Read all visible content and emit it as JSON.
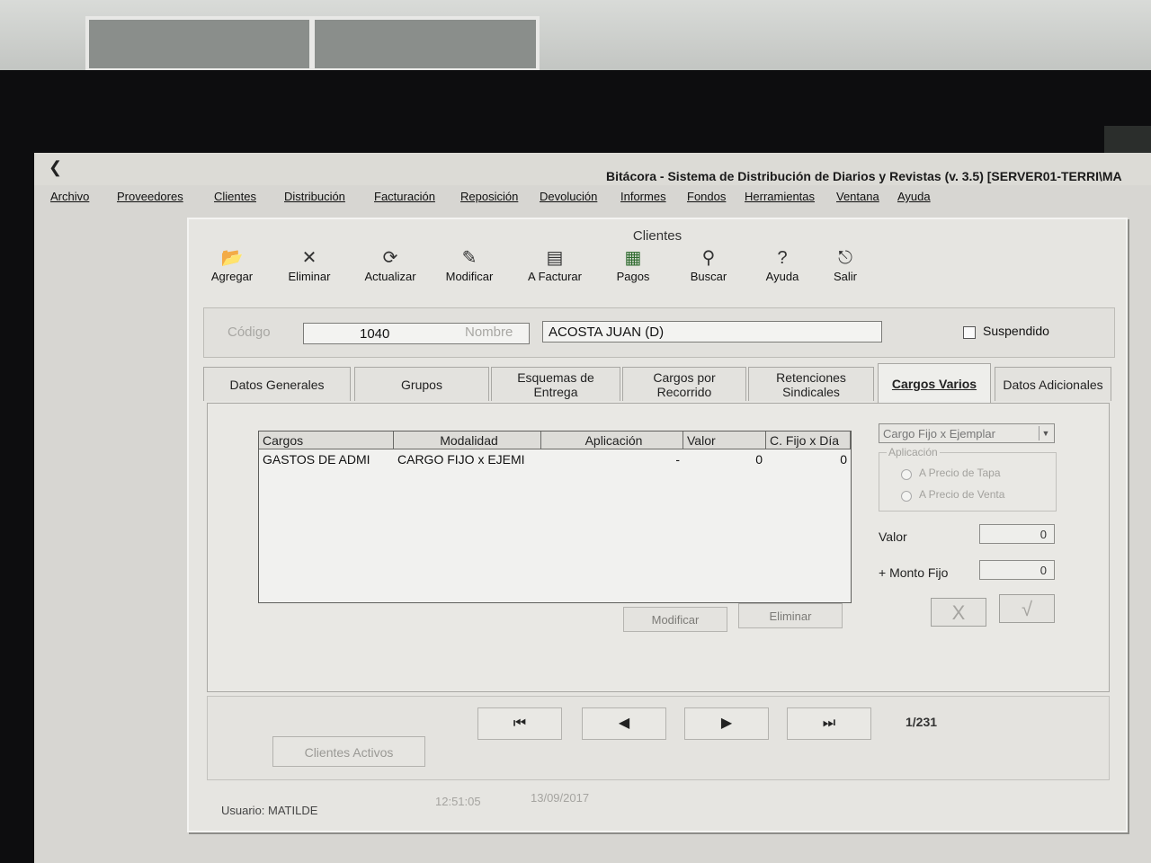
{
  "app": {
    "title": "Bitácora - Sistema de Distribución de Diarios y Revistas (v. 3.5) [SERVER01-TERRI\\MA",
    "menu": [
      "Archivo",
      "Proveedores",
      "Clientes",
      "Distribución",
      "Facturación",
      "Reposición",
      "Devolución",
      "Informes",
      "Fondos",
      "Herramientas",
      "Ventana",
      "Ayuda"
    ]
  },
  "dialog": {
    "title": "Clientes",
    "toolbar": [
      {
        "label": "Agregar",
        "icon": "folder-open-icon"
      },
      {
        "label": "Eliminar",
        "icon": "delete-x-icon"
      },
      {
        "label": "Actualizar",
        "icon": "refresh-document-icon"
      },
      {
        "label": "Modificar",
        "icon": "edit-document-icon"
      },
      {
        "label": "A Facturar",
        "icon": "invoice-icon"
      },
      {
        "label": "Pagos",
        "icon": "payments-icon"
      },
      {
        "label": "Buscar",
        "icon": "binoculars-icon"
      },
      {
        "label": "Ayuda",
        "icon": "help-icon"
      },
      {
        "label": "Salir",
        "icon": "exit-door-icon"
      }
    ],
    "fields": {
      "codigo_label": "Código",
      "codigo_value": "1040",
      "nombre_label": "Nombre",
      "nombre_value": "ACOSTA JUAN (D)",
      "suspendido_label": "Suspendido"
    },
    "tabs": [
      "Datos Generales",
      "Grupos",
      "Esquemas de Entrega",
      "Cargos por Recorrido",
      "Retenciones Sindicales",
      "Cargos Varios",
      "Datos Adicionales"
    ],
    "active_tab": "Cargos Varios",
    "grid": {
      "headers": [
        "Cargos",
        "Modalidad",
        "Aplicación",
        "Valor",
        "C. Fijo x Día"
      ],
      "rows": [
        [
          "GASTOS DE ADMI",
          "CARGO FIJO x EJEMI",
          "-",
          "0",
          "0"
        ]
      ]
    },
    "buttons": {
      "modificar": "Modificar",
      "eliminar": "Eliminar"
    },
    "side": {
      "select_value": "Cargo Fijo x Ejemplar",
      "aplicacion_label": "Aplicación",
      "radio_tapa": "A Precio de Tapa",
      "radio_venta": "A Precio de Venta",
      "valor_label": "Valor",
      "valor_value": "0",
      "monto_label": "+ Monto Fijo",
      "monto_value": "0",
      "cancel_glyph": "X",
      "ok_glyph": "√"
    },
    "nav": {
      "counter": "1/231",
      "clientes_activos": "Clientes Activos"
    },
    "status": {
      "usuario": "Usuario: MATILDE",
      "hora": "12:51:05",
      "fecha": "13/09/2017"
    }
  }
}
